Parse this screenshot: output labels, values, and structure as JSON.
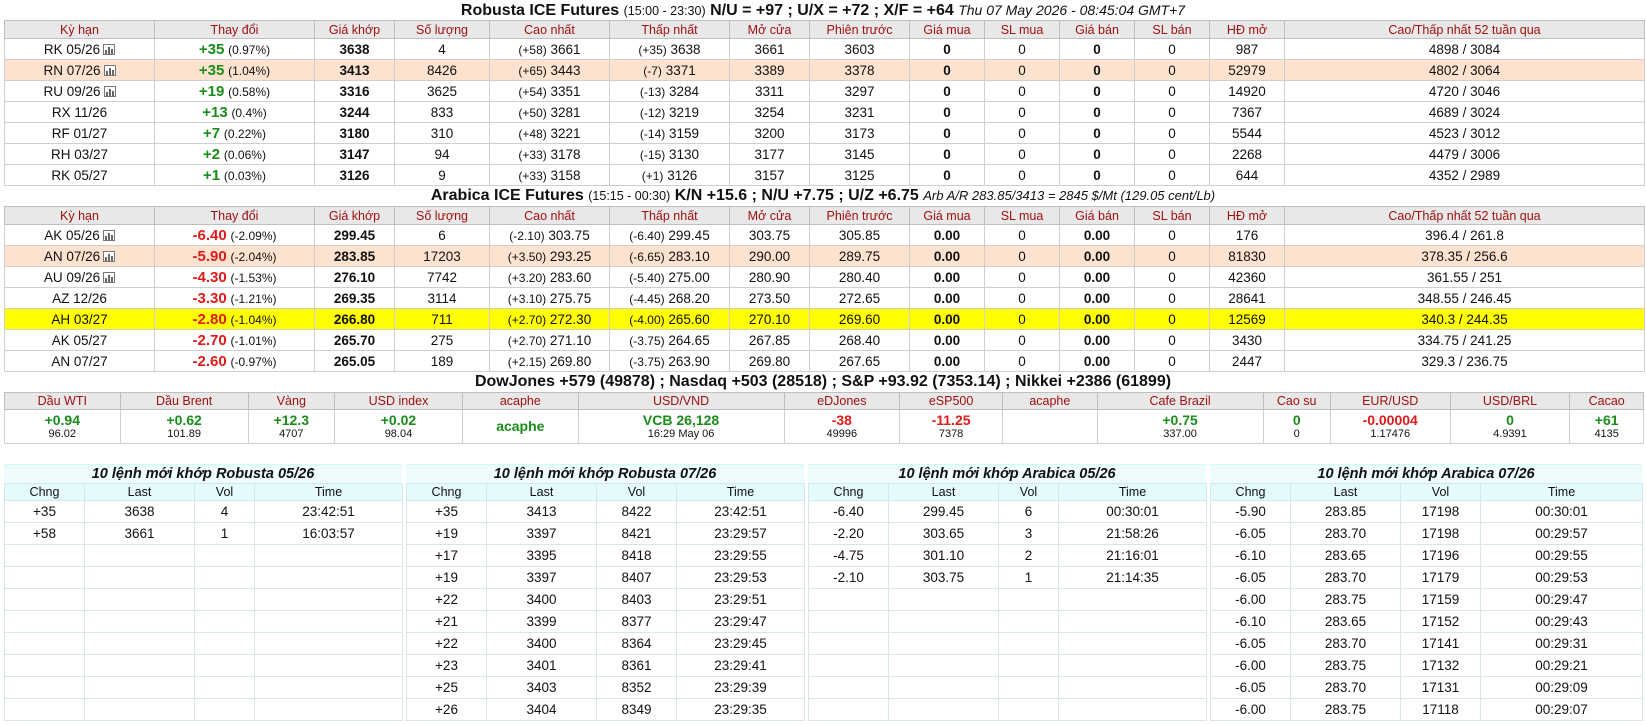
{
  "robusta": {
    "title": "Robusta ICE Futures",
    "hours": "(15:00 - 23:30)",
    "spreads": "N/U = +97 ; U/X = +72 ; X/F = +64",
    "datetime": "Thu 07 May 2026 - 08:45:04 GMT+7",
    "headers": [
      "Kỳ hạn",
      "Thay đổi",
      "Giá khớp",
      "Số lượng",
      "Cao nhất",
      "Thấp nhất",
      "Mở cửa",
      "Phiên trước",
      "Giá mua",
      "SL mua",
      "Giá bán",
      "SL bán",
      "HĐ mở",
      "Cao/Thấp nhất 52 tuần qua"
    ],
    "rows": [
      {
        "term": "RK 05/26",
        "chart": true,
        "chg": "+35",
        "pct": "(0.97%)",
        "dir": "up",
        "last": "3638",
        "vol": "4",
        "hi_chg": "(+58)",
        "hi": "3661",
        "lo_chg": "(+35)",
        "lo": "3638",
        "open": "3661",
        "prev": "3603",
        "bid": "0",
        "bidq": "0",
        "ask": "0",
        "askq": "0",
        "oi": "987",
        "wk52": "4898 / 3084"
      },
      {
        "term": "RN 07/26",
        "chart": true,
        "chg": "+35",
        "pct": "(1.04%)",
        "dir": "up",
        "last": "3413",
        "vol": "8426",
        "hi_chg": "(+65)",
        "hi": "3443",
        "lo_chg": "(-7)",
        "lo": "3371",
        "open": "3389",
        "prev": "3378",
        "bid": "0",
        "bidq": "0",
        "ask": "0",
        "askq": "0",
        "oi": "52979",
        "wk52": "4802 / 3064",
        "hl": "orange"
      },
      {
        "term": "RU 09/26",
        "chart": true,
        "chg": "+19",
        "pct": "(0.58%)",
        "dir": "up",
        "last": "3316",
        "vol": "3625",
        "hi_chg": "(+54)",
        "hi": "3351",
        "lo_chg": "(-13)",
        "lo": "3284",
        "open": "3311",
        "prev": "3297",
        "bid": "0",
        "bidq": "0",
        "ask": "0",
        "askq": "0",
        "oi": "14920",
        "wk52": "4720 / 3046"
      },
      {
        "term": "RX 11/26",
        "chart": false,
        "chg": "+13",
        "pct": "(0.4%)",
        "dir": "up",
        "last": "3244",
        "vol": "833",
        "hi_chg": "(+50)",
        "hi": "3281",
        "lo_chg": "(-12)",
        "lo": "3219",
        "open": "3254",
        "prev": "3231",
        "bid": "0",
        "bidq": "0",
        "ask": "0",
        "askq": "0",
        "oi": "7367",
        "wk52": "4689 / 3024"
      },
      {
        "term": "RF 01/27",
        "chart": false,
        "chg": "+7",
        "pct": "(0.22%)",
        "dir": "up",
        "last": "3180",
        "vol": "310",
        "hi_chg": "(+48)",
        "hi": "3221",
        "lo_chg": "(-14)",
        "lo": "3159",
        "open": "3200",
        "prev": "3173",
        "bid": "0",
        "bidq": "0",
        "ask": "0",
        "askq": "0",
        "oi": "5544",
        "wk52": "4523 / 3012"
      },
      {
        "term": "RH 03/27",
        "chart": false,
        "chg": "+2",
        "pct": "(0.06%)",
        "dir": "up",
        "last": "3147",
        "vol": "94",
        "hi_chg": "(+33)",
        "hi": "3178",
        "lo_chg": "(-15)",
        "lo": "3130",
        "open": "3177",
        "prev": "3145",
        "bid": "0",
        "bidq": "0",
        "ask": "0",
        "askq": "0",
        "oi": "2268",
        "wk52": "4479 / 3006"
      },
      {
        "term": "RK 05/27",
        "chart": false,
        "chg": "+1",
        "pct": "(0.03%)",
        "dir": "up",
        "last": "3126",
        "vol": "9",
        "hi_chg": "(+33)",
        "hi": "3158",
        "lo_chg": "(+1)",
        "lo": "3126",
        "open": "3157",
        "prev": "3125",
        "bid": "0",
        "bidq": "0",
        "ask": "0",
        "askq": "0",
        "oi": "644",
        "wk52": "4352 / 2989"
      }
    ]
  },
  "arabica": {
    "title": "Arabica ICE Futures",
    "hours": "(15:15 - 00:30)",
    "spreads": "K/N +15.6 ; N/U +7.75 ; U/Z +6.75",
    "arb": "Arb A/R 283.85/3413 = 2845 $/Mt (129.05 cent/Lb)",
    "headers": [
      "Kỳ hạn",
      "Thay đổi",
      "Giá khớp",
      "Số lượng",
      "Cao nhất",
      "Thấp nhất",
      "Mở cửa",
      "Phiên trước",
      "Giá mua",
      "SL mua",
      "Giá bán",
      "SL bán",
      "HĐ mở",
      "Cao/Thấp nhất 52 tuần qua"
    ],
    "rows": [
      {
        "term": "AK 05/26",
        "chart": true,
        "chg": "-6.40",
        "pct": "(-2.09%)",
        "dir": "dn",
        "last": "299.45",
        "vol": "6",
        "hi_chg": "(-2.10)",
        "hi": "303.75",
        "lo_chg": "(-6.40)",
        "lo": "299.45",
        "open": "303.75",
        "prev": "305.85",
        "bid": "0.00",
        "bidq": "0",
        "ask": "0.00",
        "askq": "0",
        "oi": "176",
        "wk52": "396.4 / 261.8"
      },
      {
        "term": "AN 07/26",
        "chart": true,
        "chg": "-5.90",
        "pct": "(-2.04%)",
        "dir": "dn",
        "last": "283.85",
        "vol": "17203",
        "hi_chg": "(+3.50)",
        "hi": "293.25",
        "lo_chg": "(-6.65)",
        "lo": "283.10",
        "open": "290.00",
        "prev": "289.75",
        "bid": "0.00",
        "bidq": "0",
        "ask": "0.00",
        "askq": "0",
        "oi": "81830",
        "wk52": "378.35 / 256.6",
        "hl": "orange"
      },
      {
        "term": "AU 09/26",
        "chart": true,
        "chg": "-4.30",
        "pct": "(-1.53%)",
        "dir": "dn",
        "last": "276.10",
        "vol": "7742",
        "hi_chg": "(+3.20)",
        "hi": "283.60",
        "lo_chg": "(-5.40)",
        "lo": "275.00",
        "open": "280.90",
        "prev": "280.40",
        "bid": "0.00",
        "bidq": "0",
        "ask": "0.00",
        "askq": "0",
        "oi": "42360",
        "wk52": "361.55 / 251"
      },
      {
        "term": "AZ 12/26",
        "chart": false,
        "chg": "-3.30",
        "pct": "(-1.21%)",
        "dir": "dn",
        "last": "269.35",
        "vol": "3114",
        "hi_chg": "(+3.10)",
        "hi": "275.75",
        "lo_chg": "(-4.45)",
        "lo": "268.20",
        "open": "273.50",
        "prev": "272.65",
        "bid": "0.00",
        "bidq": "0",
        "ask": "0.00",
        "askq": "0",
        "oi": "28641",
        "wk52": "348.55 / 246.45"
      },
      {
        "term": "AH 03/27",
        "chart": false,
        "chg": "-2.80",
        "pct": "(-1.04%)",
        "dir": "dn",
        "last": "266.80",
        "vol": "711",
        "hi_chg": "(+2.70)",
        "hi": "272.30",
        "lo_chg": "(-4.00)",
        "lo": "265.60",
        "open": "270.10",
        "prev": "269.60",
        "bid": "0.00",
        "bidq": "0",
        "ask": "0.00",
        "askq": "0",
        "oi": "12569",
        "wk52": "340.3 / 244.35",
        "hl": "yellow"
      },
      {
        "term": "AK 05/27",
        "chart": false,
        "chg": "-2.70",
        "pct": "(-1.01%)",
        "dir": "dn",
        "last": "265.70",
        "vol": "275",
        "hi_chg": "(+2.70)",
        "hi": "271.10",
        "lo_chg": "(-3.75)",
        "lo": "264.65",
        "open": "267.85",
        "prev": "268.40",
        "bid": "0.00",
        "bidq": "0",
        "ask": "0.00",
        "askq": "0",
        "oi": "3430",
        "wk52": "334.75 / 241.25"
      },
      {
        "term": "AN 07/27",
        "chart": false,
        "chg": "-2.60",
        "pct": "(-0.97%)",
        "dir": "dn",
        "last": "265.05",
        "vol": "189",
        "hi_chg": "(+2.15)",
        "hi": "269.80",
        "lo_chg": "(-3.75)",
        "lo": "263.90",
        "open": "269.80",
        "prev": "267.65",
        "bid": "0.00",
        "bidq": "0",
        "ask": "0.00",
        "askq": "0",
        "oi": "2447",
        "wk52": "329.3 / 236.75"
      }
    ]
  },
  "indices": {
    "title": "DowJones +579 (49878) ; Nasdaq +503 (28518) ; S&P +93.92 (7353.14) ; Nikkei +2386 (61899)",
    "cols": [
      {
        "name": "Dầu WTI",
        "v": "+0.94",
        "s": "96.02",
        "dir": "up"
      },
      {
        "name": "Dầu Brent",
        "v": "+0.62",
        "s": "101.89",
        "dir": "up"
      },
      {
        "name": "Vàng",
        "v": "+12.3",
        "s": "4707",
        "dir": "up"
      },
      {
        "name": "USD index",
        "v": "+0.02",
        "s": "98.04",
        "dir": "up"
      },
      {
        "name": "acaphe",
        "v": "acaphe",
        "s": "",
        "dir": "up"
      },
      {
        "name": "USD/VND",
        "v": "VCB 26,128",
        "s": "16:29 May 06",
        "dir": "up"
      },
      {
        "name": "eDJones",
        "v": "-38",
        "s": "49996",
        "dir": "dn"
      },
      {
        "name": "eSP500",
        "v": "-11.25",
        "s": "7378",
        "dir": "dn"
      },
      {
        "name": "acaphe",
        "v": "",
        "s": "",
        "dir": "up"
      },
      {
        "name": "Cafe Brazil",
        "v": "+0.75",
        "s": "337.00",
        "dir": "up"
      },
      {
        "name": "Cao su",
        "v": "0",
        "s": "0",
        "dir": "up"
      },
      {
        "name": "EUR/USD",
        "v": "-0.00004",
        "s": "1.17476",
        "dir": "dn"
      },
      {
        "name": "USD/BRL",
        "v": "0",
        "s": "4.9391",
        "dir": "up"
      },
      {
        "name": "Cacao",
        "v": "+61",
        "s": "4135",
        "dir": "up"
      }
    ]
  },
  "trades": {
    "headers": [
      "Chng",
      "Last",
      "Vol",
      "Time"
    ],
    "blocks": [
      {
        "title": "10 lệnh mới khớp Robusta 05/26",
        "rows": [
          [
            "+35",
            "3638",
            "4",
            "23:42:51"
          ],
          [
            "+58",
            "3661",
            "1",
            "16:03:57"
          ]
        ]
      },
      {
        "title": "10 lệnh mới khớp Robusta 07/26",
        "rows": [
          [
            "+35",
            "3413",
            "8422",
            "23:42:51"
          ],
          [
            "+19",
            "3397",
            "8421",
            "23:29:57"
          ],
          [
            "+17",
            "3395",
            "8418",
            "23:29:55"
          ],
          [
            "+19",
            "3397",
            "8407",
            "23:29:53"
          ],
          [
            "+22",
            "3400",
            "8403",
            "23:29:51"
          ],
          [
            "+21",
            "3399",
            "8377",
            "23:29:47"
          ],
          [
            "+22",
            "3400",
            "8364",
            "23:29:45"
          ],
          [
            "+23",
            "3401",
            "8361",
            "23:29:41"
          ],
          [
            "+25",
            "3403",
            "8352",
            "23:29:39"
          ],
          [
            "+26",
            "3404",
            "8349",
            "23:29:35"
          ]
        ]
      },
      {
        "title": "10 lệnh mới khớp Arabica 05/26",
        "rows": [
          [
            "-6.40",
            "299.45",
            "6",
            "00:30:01"
          ],
          [
            "-2.20",
            "303.65",
            "3",
            "21:58:26"
          ],
          [
            "-4.75",
            "301.10",
            "2",
            "21:16:01"
          ],
          [
            "-2.10",
            "303.75",
            "1",
            "21:14:35"
          ]
        ]
      },
      {
        "title": "10 lệnh mới khớp Arabica 07/26",
        "rows": [
          [
            "-5.90",
            "283.85",
            "17198",
            "00:30:01"
          ],
          [
            "-6.05",
            "283.70",
            "17198",
            "00:29:57"
          ],
          [
            "-6.10",
            "283.65",
            "17196",
            "00:29:55"
          ],
          [
            "-6.05",
            "283.70",
            "17179",
            "00:29:53"
          ],
          [
            "-6.00",
            "283.75",
            "17159",
            "00:29:47"
          ],
          [
            "-6.10",
            "283.65",
            "17152",
            "00:29:43"
          ],
          [
            "-6.05",
            "283.70",
            "17141",
            "00:29:31"
          ],
          [
            "-6.00",
            "283.75",
            "17132",
            "00:29:21"
          ],
          [
            "-6.05",
            "283.70",
            "17131",
            "00:29:09"
          ],
          [
            "-6.00",
            "283.75",
            "17118",
            "00:29:07"
          ]
        ]
      }
    ]
  },
  "colors": {
    "up": "#1a8c1a",
    "down": "#e11a1a",
    "header_text": "#a01010",
    "highlight_orange": "#fde3cf",
    "highlight_yellow": "#ffff00"
  }
}
